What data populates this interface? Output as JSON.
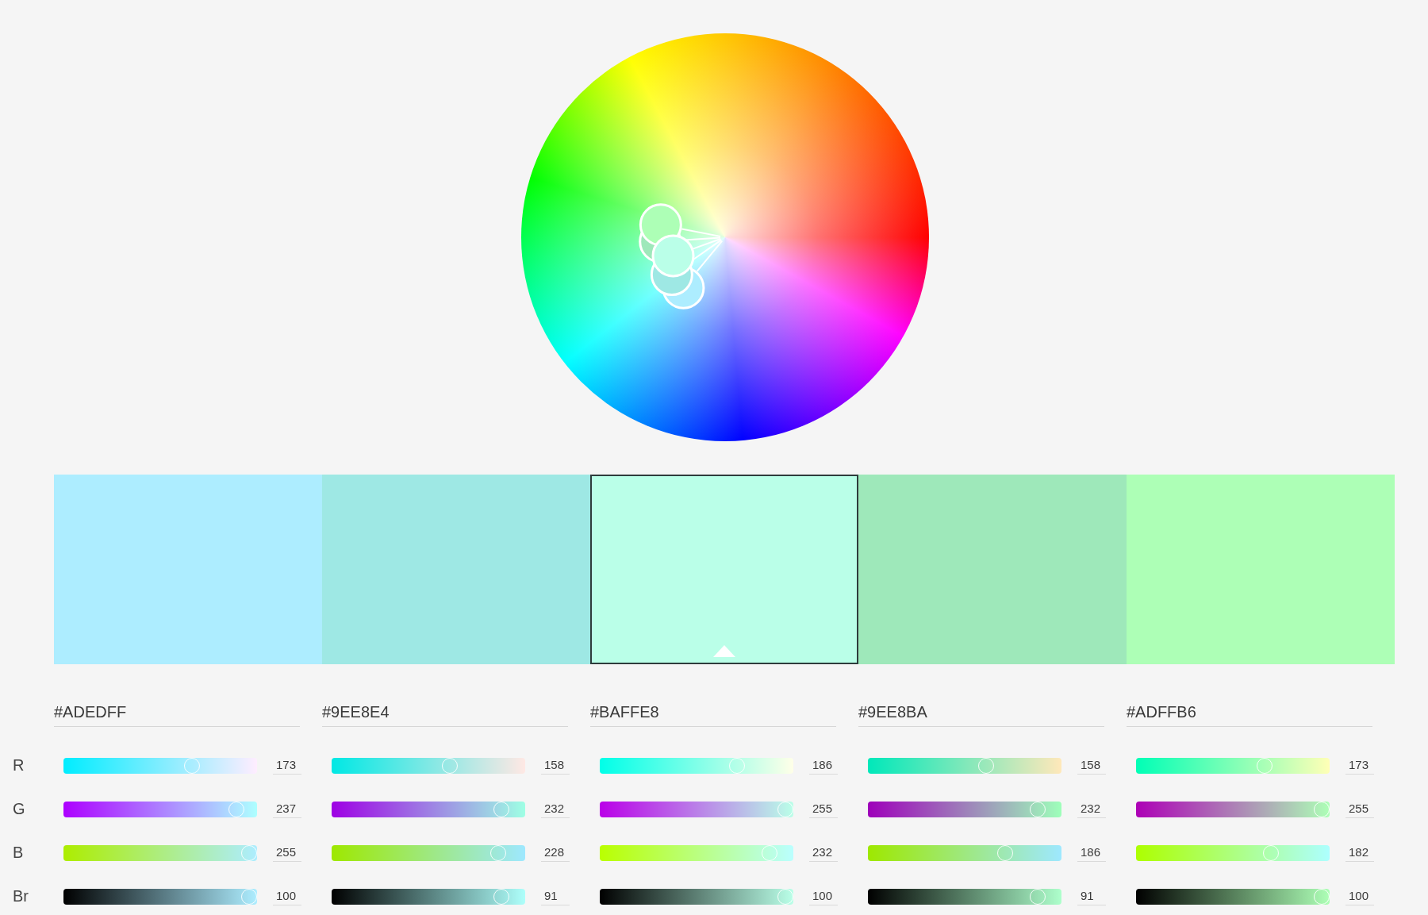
{
  "channels": [
    {
      "label": "R",
      "kind": "red"
    },
    {
      "label": "G",
      "kind": "green"
    },
    {
      "label": "B",
      "kind": "blue"
    },
    {
      "label": "Br",
      "kind": "brightness"
    }
  ],
  "colors": [
    {
      "color": "#adedff",
      "selected": false,
      "hex": "#ADEDFF",
      "values": [
        {
          "value": "173",
          "level": 0.678
        },
        {
          "value": "237",
          "level": 0.929
        },
        {
          "value": "255",
          "level": 1
        },
        {
          "value": "100",
          "level": 1
        }
      ]
    },
    {
      "color": "#9ee8e4",
      "selected": false,
      "hex": "#9EE8E4",
      "values": [
        {
          "value": "158",
          "level": 0.62
        },
        {
          "value": "232",
          "level": 0.91
        },
        {
          "value": "228",
          "level": 0.894
        },
        {
          "value": "91",
          "level": 0.91
        }
      ]
    },
    {
      "color": "#baffe8",
      "selected": true,
      "hex": "#BAFFE8",
      "values": [
        {
          "value": "186",
          "level": 0.729
        },
        {
          "value": "255",
          "level": 1
        },
        {
          "value": "232",
          "level": 0.91
        },
        {
          "value": "100",
          "level": 1
        }
      ]
    },
    {
      "color": "#9ee8ba",
      "selected": false,
      "hex": "#9EE8BA",
      "values": [
        {
          "value": "158",
          "level": 0.62
        },
        {
          "value": "232",
          "level": 0.91
        },
        {
          "value": "186",
          "level": 0.729
        },
        {
          "value": "91",
          "level": 0.91
        }
      ]
    },
    {
      "color": "#adffb6",
      "selected": false,
      "hex": "#ADFFB6",
      "values": [
        {
          "value": "173",
          "level": 0.678
        },
        {
          "value": "255",
          "level": 1
        },
        {
          "value": "182",
          "level": 0.714
        },
        {
          "value": "100",
          "level": 1
        }
      ]
    }
  ]
}
